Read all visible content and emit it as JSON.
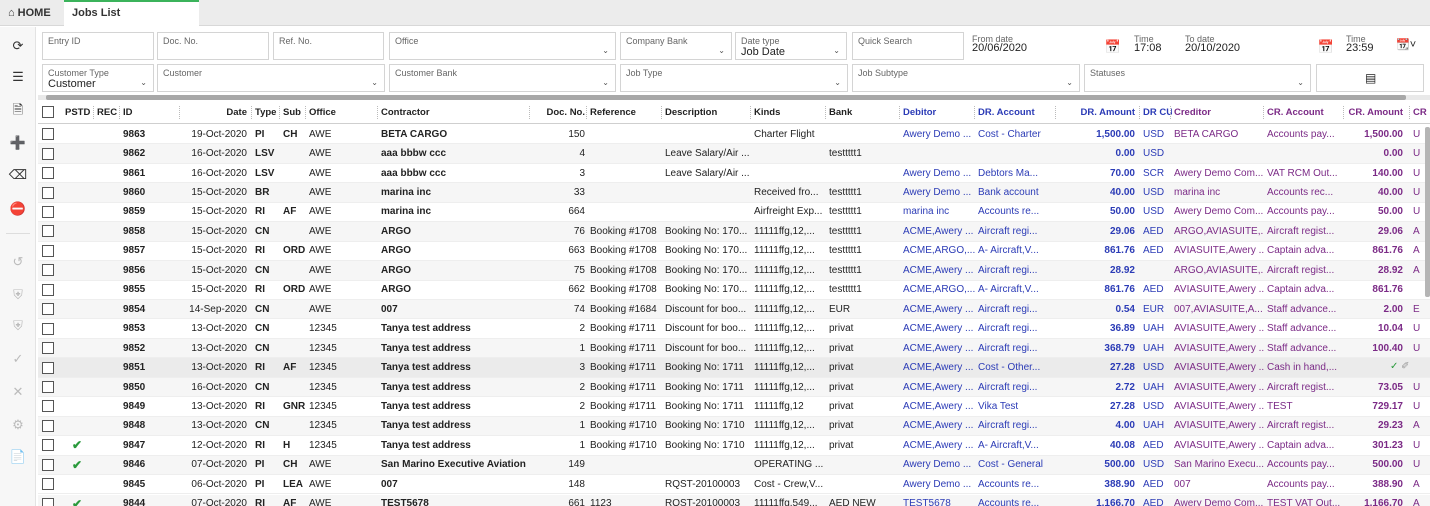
{
  "tabs": {
    "home": "HOME",
    "active": "Jobs List"
  },
  "icons": {
    "home": "home-icon",
    "sidebar": [
      "refresh-icon",
      "filter-settings-icon",
      "document-icon",
      "add-icon",
      "eraser-icon",
      "remove-icon",
      "undo-icon",
      "shield-check-icon",
      "shield-x-icon",
      "check-icon",
      "close-icon",
      "gear-icon",
      "report-icon"
    ]
  },
  "filters": {
    "entry_id": {
      "label": "Entry ID",
      "value": ""
    },
    "doc_no": {
      "label": "Doc. No.",
      "value": ""
    },
    "ref_no": {
      "label": "Ref. No.",
      "value": ""
    },
    "office": {
      "label": "Office",
      "value": ""
    },
    "company_bank": {
      "label": "Company Bank",
      "value": ""
    },
    "date_type": {
      "label": "Date type",
      "value": "Job Date"
    },
    "quick_search": {
      "label": "Quick Search",
      "value": ""
    },
    "from_date": {
      "label": "From date",
      "value": "20/06/2020"
    },
    "from_time": {
      "label": "Time",
      "value": "17:08"
    },
    "to_date": {
      "label": "To date",
      "value": "20/10/2020"
    },
    "to_time": {
      "label": "Time",
      "value": "23:59"
    },
    "customer_type": {
      "label": "Customer Type",
      "value": "Customer"
    },
    "customer": {
      "label": "Customer",
      "value": ""
    },
    "customer_bank": {
      "label": "Customer Bank",
      "value": ""
    },
    "job_type": {
      "label": "Job Type",
      "value": ""
    },
    "job_subtype": {
      "label": "Job Subtype",
      "value": ""
    },
    "statuses": {
      "label": "Statuses",
      "value": ""
    }
  },
  "columns": [
    "PSTD",
    "REC",
    "ID",
    "Date",
    "Type",
    "Sub",
    "Office",
    "Contractor",
    "Doc. No.",
    "Reference",
    "Description",
    "Kinds",
    "Bank",
    "Debitor",
    "DR. Account",
    "DR. Amount",
    "DR CUR",
    "Creditor",
    "CR. Account",
    "CR. Amount",
    "CR"
  ],
  "rows": [
    {
      "pstd": "",
      "rec": "",
      "id": "9863",
      "date": "19-Oct-2020",
      "type": "PI",
      "sub": "CH",
      "office": "AWE",
      "contractor": "BETA CARGO",
      "doc": "150",
      "reference": "",
      "description": "",
      "kinds": "Charter Flight",
      "bank": "",
      "debitor": "Awery Demo ...",
      "dr_account": "Cost - Charter",
      "dr_amount": "1,500.00",
      "dr_cur": "USD",
      "creditor": "BETA CARGO",
      "cr_account": "Accounts pay...",
      "cr_amount": "1,500.00",
      "cr": "U"
    },
    {
      "pstd": "",
      "rec": "",
      "id": "9862",
      "date": "16-Oct-2020",
      "type": "LSV",
      "sub": "",
      "office": "AWE",
      "contractor": "aaa bbbw ccc",
      "doc": "4",
      "reference": "",
      "description": "Leave Salary/Air ...",
      "kinds": "",
      "bank": "testtttt1",
      "debitor": "",
      "dr_account": "",
      "dr_amount": "0.00",
      "dr_cur": "USD",
      "creditor": "",
      "cr_account": "",
      "cr_amount": "0.00",
      "cr": "U"
    },
    {
      "pstd": "",
      "rec": "",
      "id": "9861",
      "date": "16-Oct-2020",
      "type": "LSV",
      "sub": "",
      "office": "AWE",
      "contractor": "aaa bbbw ccc",
      "doc": "3",
      "reference": "",
      "description": "Leave Salary/Air ...",
      "kinds": "",
      "bank": "",
      "debitor": "Awery Demo ...",
      "dr_account": "Debtors Ma...",
      "dr_amount": "70.00",
      "dr_cur": "SCR",
      "creditor": "Awery Demo Com...",
      "cr_account": "VAT RCM Out...",
      "cr_amount": "140.00",
      "cr": "U"
    },
    {
      "pstd": "",
      "rec": "",
      "id": "9860",
      "date": "15-Oct-2020",
      "type": "BR",
      "sub": "",
      "office": "AWE",
      "contractor": "marina inc",
      "doc": "33",
      "reference": "",
      "description": "",
      "kinds": "Received fro...",
      "bank": "testtttt1",
      "debitor": "Awery Demo ...",
      "dr_account": "Bank account",
      "dr_amount": "40.00",
      "dr_cur": "USD",
      "creditor": "marina inc",
      "cr_account": "Accounts rec...",
      "cr_amount": "40.00",
      "cr": "U"
    },
    {
      "pstd": "",
      "rec": "",
      "id": "9859",
      "date": "15-Oct-2020",
      "type": "RI",
      "sub": "AF",
      "office": "AWE",
      "contractor": "marina inc",
      "doc": "664",
      "reference": "",
      "description": "",
      "kinds": "Airfreight Exp...",
      "bank": "testtttt1",
      "debitor": "marina inc",
      "dr_account": "Accounts re...",
      "dr_amount": "50.00",
      "dr_cur": "USD",
      "creditor": "Awery Demo Com...",
      "cr_account": "Accounts pay...",
      "cr_amount": "50.00",
      "cr": "U"
    },
    {
      "pstd": "",
      "rec": "",
      "id": "9858",
      "date": "15-Oct-2020",
      "type": "CN",
      "sub": "",
      "office": "AWE",
      "contractor": "ARGO",
      "doc": "76",
      "reference": "Booking #1708",
      "description": "Booking No: 170...",
      "kinds": "11111ffg,12,...",
      "bank": "testtttt1",
      "debitor": "ACME,Awery ...",
      "dr_account": "Aircraft regi...",
      "dr_amount": "29.06",
      "dr_cur": "AED",
      "creditor": "ARGO,AVIASUITE,...",
      "cr_account": "Aircraft regist...",
      "cr_amount": "29.06",
      "cr": "A"
    },
    {
      "pstd": "",
      "rec": "",
      "id": "9857",
      "date": "15-Oct-2020",
      "type": "RI",
      "sub": "ORD",
      "office": "AWE",
      "contractor": "ARGO",
      "doc": "663",
      "reference": "Booking #1708",
      "description": "Booking No: 170...",
      "kinds": "11111ffg,12,...",
      "bank": "testtttt1",
      "debitor": "ACME,ARGO,...",
      "dr_account": "A- Aircraft,V...",
      "dr_amount": "861.76",
      "dr_cur": "AED",
      "creditor": "AVIASUITE,Awery ...",
      "cr_account": "Captain adva...",
      "cr_amount": "861.76",
      "cr": "A"
    },
    {
      "pstd": "",
      "rec": "",
      "id": "9856",
      "date": "15-Oct-2020",
      "type": "CN",
      "sub": "",
      "office": "AWE",
      "contractor": "ARGO",
      "doc": "75",
      "reference": "Booking #1708",
      "description": "Booking No: 170...",
      "kinds": "11111ffg,12,...",
      "bank": "testtttt1",
      "debitor": "ACME,Awery ...",
      "dr_account": "Aircraft regi...",
      "dr_amount": "28.92",
      "dr_cur": "",
      "creditor": "ARGO,AVIASUITE,...",
      "cr_account": "Aircraft regist...",
      "cr_amount": "28.92",
      "cr": "A"
    },
    {
      "pstd": "",
      "rec": "",
      "id": "9855",
      "date": "15-Oct-2020",
      "type": "RI",
      "sub": "ORD",
      "office": "AWE",
      "contractor": "ARGO",
      "doc": "662",
      "reference": "Booking #1708",
      "description": "Booking No: 170...",
      "kinds": "11111ffg,12,...",
      "bank": "testtttt1",
      "debitor": "ACME,ARGO,...",
      "dr_account": "A- Aircraft,V...",
      "dr_amount": "861.76",
      "dr_cur": "AED",
      "creditor": "AVIASUITE,Awery ...",
      "cr_account": "Captain adva...",
      "cr_amount": "861.76",
      "cr": ""
    },
    {
      "pstd": "",
      "rec": "",
      "id": "9854",
      "date": "14-Sep-2020",
      "type": "CN",
      "sub": "",
      "office": "AWE",
      "contractor": "007",
      "doc": "74",
      "reference": "Booking #1684",
      "description": "Discount for boo...",
      "kinds": "11111ffg,12,...",
      "bank": "EUR",
      "debitor": "ACME,Awery ...",
      "dr_account": "Aircraft regi...",
      "dr_amount": "0.54",
      "dr_cur": "EUR",
      "creditor": "007,AVIASUITE,A...",
      "cr_account": "Staff advance...",
      "cr_amount": "2.00",
      "cr": "E"
    },
    {
      "pstd": "",
      "rec": "",
      "id": "9853",
      "date": "13-Oct-2020",
      "type": "CN",
      "sub": "",
      "office": "12345",
      "contractor": "Tanya test address",
      "doc": "2",
      "reference": "Booking #1711",
      "description": "Discount for boo...",
      "kinds": "11111ffg,12,...",
      "bank": "privat",
      "debitor": "ACME,Awery ...",
      "dr_account": "Aircraft regi...",
      "dr_amount": "36.89",
      "dr_cur": "UAH",
      "creditor": "AVIASUITE,Awery ...",
      "cr_account": "Staff advance...",
      "cr_amount": "10.04",
      "cr": "U"
    },
    {
      "pstd": "",
      "rec": "",
      "id": "9852",
      "date": "13-Oct-2020",
      "type": "CN",
      "sub": "",
      "office": "12345",
      "contractor": "Tanya test address",
      "doc": "1",
      "reference": "Booking #1711",
      "description": "Discount for boo...",
      "kinds": "11111ffg,12,...",
      "bank": "privat",
      "debitor": "ACME,Awery ...",
      "dr_account": "Aircraft regi...",
      "dr_amount": "368.79",
      "dr_cur": "UAH",
      "creditor": "AVIASUITE,Awery ...",
      "cr_account": "Staff advance...",
      "cr_amount": "100.40",
      "cr": "U"
    },
    {
      "pstd": "",
      "rec": "",
      "id": "9851",
      "date": "13-Oct-2020",
      "type": "RI",
      "sub": "AF",
      "office": "12345",
      "contractor": "Tanya test address",
      "doc": "3",
      "reference": "Booking #1711",
      "description": "Booking No: 1711",
      "kinds": "11111ffg,12,...",
      "bank": "privat",
      "debitor": "ACME,Awery ...",
      "dr_account": "Cost - Other...",
      "dr_amount": "27.28",
      "dr_cur": "USD",
      "creditor": "AVIASUITE,Awery ...",
      "cr_account": "Cash in hand,...",
      "cr_amount": "",
      "cr": ""
    },
    {
      "pstd": "",
      "rec": "",
      "id": "9850",
      "date": "16-Oct-2020",
      "type": "CN",
      "sub": "",
      "office": "12345",
      "contractor": "Tanya test address",
      "doc": "2",
      "reference": "Booking #1711",
      "description": "Booking No: 1711",
      "kinds": "11111ffg,12,...",
      "bank": "privat",
      "debitor": "ACME,Awery ...",
      "dr_account": "Aircraft regi...",
      "dr_amount": "2.72",
      "dr_cur": "UAH",
      "creditor": "AVIASUITE,Awery ...",
      "cr_account": "Aircraft regist...",
      "cr_amount": "73.05",
      "cr": "U"
    },
    {
      "pstd": "",
      "rec": "",
      "id": "9849",
      "date": "13-Oct-2020",
      "type": "RI",
      "sub": "GNR",
      "office": "12345",
      "contractor": "Tanya test address",
      "doc": "2",
      "reference": "Booking #1711",
      "description": "Booking No: 1711",
      "kinds": "11111ffg,12",
      "bank": "privat",
      "debitor": "ACME,Awery ...",
      "dr_account": "Vika Test",
      "dr_amount": "27.28",
      "dr_cur": "USD",
      "creditor": "AVIASUITE,Awery ...",
      "cr_account": "TEST",
      "cr_amount": "729.17",
      "cr": "U"
    },
    {
      "pstd": "",
      "rec": "",
      "id": "9848",
      "date": "13-Oct-2020",
      "type": "CN",
      "sub": "",
      "office": "12345",
      "contractor": "Tanya test address",
      "doc": "1",
      "reference": "Booking #1710",
      "description": "Booking No: 1710",
      "kinds": "11111ffg,12,...",
      "bank": "privat",
      "debitor": "ACME,Awery ...",
      "dr_account": "Aircraft regi...",
      "dr_amount": "4.00",
      "dr_cur": "UAH",
      "creditor": "AVIASUITE,Awery ...",
      "cr_account": "Aircraft regist...",
      "cr_amount": "29.23",
      "cr": "A"
    },
    {
      "pstd": "✔",
      "rec": "",
      "id": "9847",
      "date": "12-Oct-2020",
      "type": "RI",
      "sub": "H",
      "office": "12345",
      "contractor": "Tanya test address",
      "doc": "1",
      "reference": "Booking #1710",
      "description": "Booking No: 1710",
      "kinds": "11111ffg,12,...",
      "bank": "privat",
      "debitor": "ACME,Awery ...",
      "dr_account": "A- Aircraft,V...",
      "dr_amount": "40.08",
      "dr_cur": "AED",
      "creditor": "AVIASUITE,Awery ...",
      "cr_account": "Captain adva...",
      "cr_amount": "301.23",
      "cr": "U"
    },
    {
      "pstd": "✔",
      "rec": "",
      "id": "9846",
      "date": "07-Oct-2020",
      "type": "PI",
      "sub": "CH",
      "office": "AWE",
      "contractor": "San Marino Executive Aviation ...",
      "doc": "149",
      "reference": "",
      "description": "",
      "kinds": "OPERATING ...",
      "bank": "",
      "debitor": "Awery Demo ...",
      "dr_account": "Cost - General",
      "dr_amount": "500.00",
      "dr_cur": "USD",
      "creditor": "San Marino Execu...",
      "cr_account": "Accounts pay...",
      "cr_amount": "500.00",
      "cr": "U"
    },
    {
      "pstd": "",
      "rec": "",
      "id": "9845",
      "date": "06-Oct-2020",
      "type": "PI",
      "sub": "LEA",
      "office": "AWE",
      "contractor": "007",
      "doc": "148",
      "reference": "",
      "description": "RQST-20100003",
      "kinds": "Cost - Crew,V...",
      "bank": "",
      "debitor": "Awery Demo ...",
      "dr_account": "Accounts re...",
      "dr_amount": "388.90",
      "dr_cur": "AED",
      "creditor": "007",
      "cr_account": "Accounts pay...",
      "cr_amount": "388.90",
      "cr": "A"
    },
    {
      "pstd": "✔",
      "rec": "",
      "id": "9844",
      "date": "07-Oct-2020",
      "type": "RI",
      "sub": "AF",
      "office": "AWE",
      "contractor": "TEST5678",
      "doc": "661",
      "reference": "1123",
      "description": "RQST-20100003",
      "kinds": "11111ffg,549...",
      "bank": "AED NEW",
      "debitor": "TEST5678",
      "dr_account": "Accounts re...",
      "dr_amount": "1,166.70",
      "dr_cur": "AED",
      "creditor": "Awery Demo Com...",
      "cr_account": "TEST VAT Out...",
      "cr_amount": "1,166.70",
      "cr": "A"
    }
  ]
}
